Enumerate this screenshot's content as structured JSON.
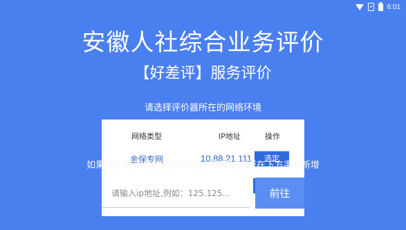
{
  "status_bar": {
    "time": "6:01",
    "icons": [
      "wifi-icon",
      "no-sim-icon",
      "battery-icon"
    ]
  },
  "title": "安徽人社综合业务评价",
  "subtitle": "【好差评】服务评价",
  "prompt": "请选择评价器所在的网络环境",
  "table": {
    "headers": [
      "网络类型",
      "IP地址",
      "操作"
    ],
    "rows": [
      {
        "type": "金保专网",
        "ip": "10.88.21.111",
        "action": "选定"
      }
    ]
  },
  "hint": "如果所在地市没有预设IP地址，您可以选择在下方手动新增",
  "ip_input": {
    "value": "",
    "placeholder": "请输入ip地址,例如：125.125..."
  },
  "go_button": "前往",
  "colors": {
    "background": "#4a7ff0",
    "accent": "#2f6be0",
    "go_button": "#5b8ef2",
    "link_text": "#2d63c8"
  }
}
